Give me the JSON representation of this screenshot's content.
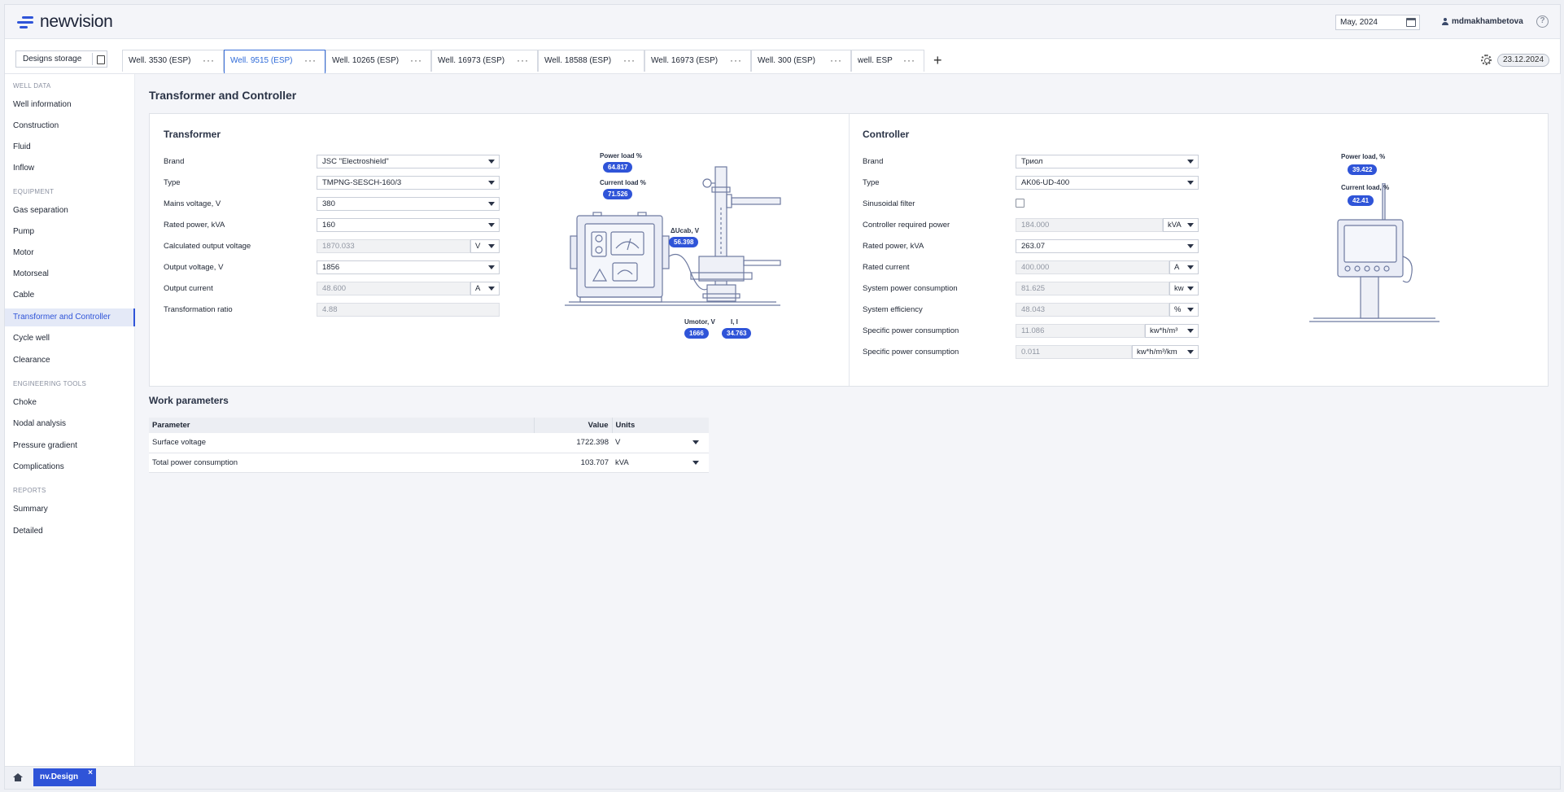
{
  "header": {
    "logo_text": "newvision",
    "date_value": "May, 2024",
    "user_name": "mdmakhambetova",
    "help_label": "?"
  },
  "toolbar": {
    "storage_label": "Designs storage",
    "tabs": [
      {
        "label": "Well. 3530 (ESP)"
      },
      {
        "label": "Well. 9515 (ESP)"
      },
      {
        "label": "Well. 10265 (ESP)"
      },
      {
        "label": "Well. 16973 (ESP)"
      },
      {
        "label": "Well. 18588 (ESP)"
      },
      {
        "label": "Well. 16973 (ESP)"
      },
      {
        "label": "Well. 300 (ESP)"
      },
      {
        "label": "well. ESP"
      }
    ],
    "tab_menu": "···",
    "add_label": "+",
    "date_badge": "23.12.2024"
  },
  "sidebar": {
    "sections": {
      "well_data": "WELL DATA",
      "equipment": "EQUIPMENT",
      "engineering_tools": "ENGINEERING TOOLS",
      "reports": "REPORTS"
    },
    "items": [
      "Well information",
      "Construction",
      "Fluid",
      "Inflow",
      "Gas separation",
      "Pump",
      "Motor",
      "Motorseal",
      "Cable",
      "Transformer and Controller",
      "Cycle well",
      "Clearance",
      "Choke",
      "Nodal analysis",
      "Pressure gradient",
      "Complications",
      "Summary",
      "Detailed"
    ]
  },
  "main": {
    "page_title": "Transformer and Controller",
    "transformer": {
      "title": "Transformer",
      "labels": {
        "brand": "Brand",
        "type": "Type",
        "mains_voltage": "Mains voltage, V",
        "rated_power": "Rated power, kVA",
        "calc_output_voltage": "Calculated output voltage",
        "output_voltage": "Output voltage, V",
        "output_current": "Output current",
        "transformation_ratio": "Transformation ratio"
      },
      "values": {
        "brand": "JSC \"Electroshield\"",
        "type": "TMPNG-SESCH-160/3",
        "mains_voltage": "380",
        "rated_power": "160",
        "calc_output_voltage": "1870.033",
        "calc_output_voltage_unit": "V",
        "output_voltage": "1856",
        "output_current": "48.600",
        "output_current_unit": "A",
        "transformation_ratio": "4.88"
      },
      "diagram": {
        "power_load_label": "Power load %",
        "power_load_value": "64.817",
        "current_load_label": "Current load %",
        "current_load_value": "71.526",
        "ucab_label": "ΔUcab, V",
        "ucab_value": "56.398",
        "umotor_label": "Umotor, V",
        "umotor_value": "1666",
        "i_label": "I, I",
        "i_value": "34.763"
      }
    },
    "controller": {
      "title": "Controller",
      "labels": {
        "brand": "Brand",
        "type": "Type",
        "sinusoidal_filter": "Sinusoidal filter",
        "required_power": "Controller required power",
        "rated_power": "Rated power, kVA",
        "rated_current": "Rated current",
        "system_power": "System power consumption",
        "system_efficiency": "System efficiency",
        "specific_power_1": "Specific power consumption",
        "specific_power_2": "Specific power consumption"
      },
      "values": {
        "brand": "Триол",
        "type": "AK06-UD-400",
        "required_power": "184.000",
        "required_power_unit": "kVA",
        "rated_power": "263.07",
        "rated_current": "400.000",
        "rated_current_unit": "A",
        "system_power": "81.625",
        "system_power_unit": "kw",
        "system_efficiency": "48.043",
        "system_efficiency_unit": "%",
        "specific_power_1": "11.086",
        "specific_power_1_unit": "kw*h/m³",
        "specific_power_2": "0.011",
        "specific_power_2_unit": "kw*h/m³/km"
      },
      "diagram": {
        "power_load_label": "Power load, %",
        "power_load_value": "39.422",
        "current_load_label": "Current load, %",
        "current_load_value": "42.41"
      }
    },
    "work_params": {
      "title": "Work parameters",
      "headers": {
        "parameter": "Parameter",
        "value": "Value",
        "units": "Units"
      },
      "rows": [
        {
          "parameter": "Surface voltage",
          "value": "1722.398",
          "unit": "V"
        },
        {
          "parameter": "Total power consumption",
          "value": "103.707",
          "unit": "kVA"
        }
      ]
    }
  },
  "footer": {
    "design_tab": "nv.Design",
    "close": "×"
  }
}
